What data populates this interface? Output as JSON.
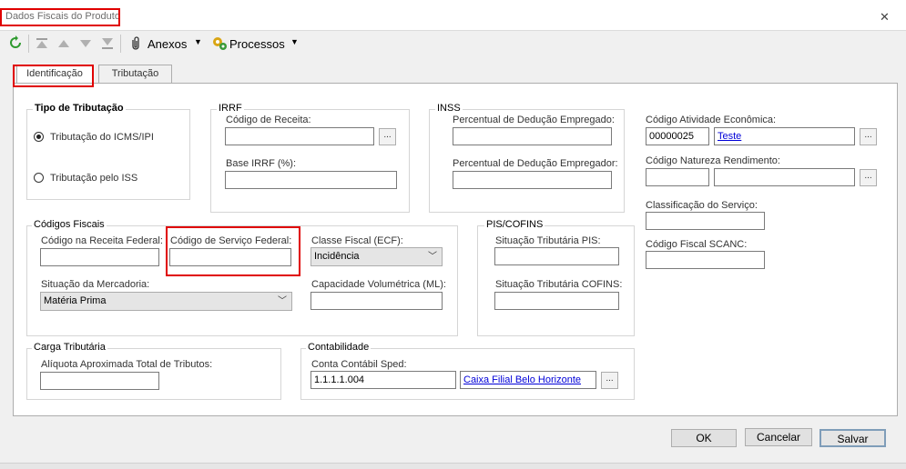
{
  "window": {
    "title": "Dados Fiscais do Produto",
    "close_glyph": "✕"
  },
  "toolbar": {
    "anexos": "Anexos",
    "processos": "Processos"
  },
  "tabs": [
    {
      "label": "Identificação"
    },
    {
      "label": "Tributação"
    }
  ],
  "tipo_tributacao": {
    "title": "Tipo de Tributação",
    "option_icms": "Tributação do ICMS/IPI",
    "option_iss": "Tributação pelo ISS",
    "selected": "Tributação do ICMS/IPI"
  },
  "irrf": {
    "title": "IRRF",
    "codigo_receita_label": "Código de Receita:",
    "codigo_receita_value": "",
    "base_label": "Base IRRF (%):",
    "base_value": ""
  },
  "inss": {
    "title": "INSS",
    "empregado_label": "Percentual de Dedução Empregado:",
    "empregado_value": "",
    "empregador_label": "Percentual de Dedução Empregador:",
    "empregador_value": ""
  },
  "right_col": {
    "atividade_label": "Código Atividade Econômica:",
    "atividade_code": "00000025",
    "atividade_desc": "Teste",
    "natureza_label": "Código Natureza Rendimento:",
    "natureza_code": "",
    "natureza_desc": "",
    "classificacao_label": "Classificação do Serviço:",
    "classificacao_value": "",
    "scanc_label": "Código Fiscal SCANC:",
    "scanc_value": ""
  },
  "codigos_fiscais": {
    "title": "Códigos Fiscais",
    "receita_federal_label": "Código na Receita Federal:",
    "receita_federal_value": "",
    "servico_federal_label": "Código de Serviço Federal:",
    "servico_federal_value": "",
    "classe_fiscal_label": "Classe Fiscal (ECF):",
    "classe_fiscal_value": "Incidência",
    "situacao_label": "Situação da Mercadoria:",
    "situacao_value": "Matéria Prima",
    "capacidade_label": "Capacidade Volumétrica (ML):",
    "capacidade_value": ""
  },
  "pis_cofins": {
    "title": "PIS/COFINS",
    "pis_label": "Situação Tributária PIS:",
    "pis_value": "",
    "cofins_label": "Situação Tributária COFINS:",
    "cofins_value": ""
  },
  "carga": {
    "title": "Carga Tributária",
    "aliquota_label": "Alíquota Aproximada Total de Tributos:",
    "aliquota_value": ""
  },
  "contabilidade": {
    "title": "Contabilidade",
    "conta_label": "Conta Contábil Sped:",
    "conta_code": "1.1.1.1.004",
    "conta_desc": "Caixa Filial Belo Horizonte"
  },
  "buttons": {
    "ok": "OK",
    "cancelar": "Cancelar",
    "salvar": "Salvar"
  },
  "common": {
    "ellipsis": "...",
    "dropdown_arrow": "﹀"
  },
  "colors": {
    "highlight": "#e00000",
    "link": "#0000d8"
  },
  "icons": [
    "refresh-icon",
    "first-icon",
    "up-icon",
    "down-icon",
    "last-icon",
    "paperclip-icon",
    "gears-icon"
  ]
}
